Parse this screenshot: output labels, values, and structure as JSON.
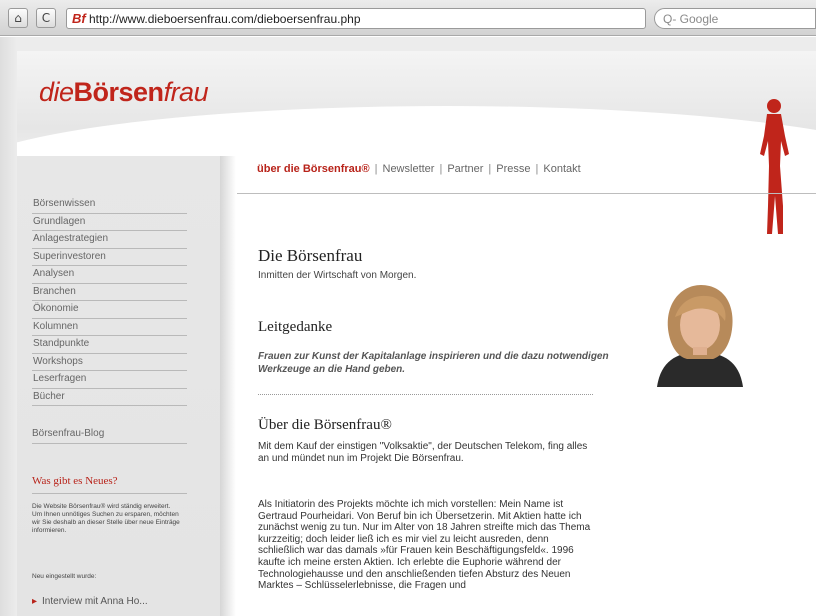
{
  "browser": {
    "home_glyph": "⌂",
    "reload_glyph": "C",
    "favicon_text": "Bf",
    "url": "http://www.dieboersenfrau.com/dieboersenfrau.php",
    "rss_glyph": "◉",
    "search_placeholder": "Q- Google"
  },
  "site": {
    "logo_pre": "die",
    "logo_bold": "Börsen",
    "logo_post": "frau",
    "top_nav": {
      "active": "über die Börsenfrau®",
      "items": [
        "Newsletter",
        "Partner",
        "Presse",
        "Kontakt"
      ],
      "separator": "|"
    },
    "side_menu": [
      "Börsenwissen",
      "Grundlagen",
      "Anlagestrategien",
      "Superinvestoren",
      "Analysen",
      "Branchen",
      "Ökonomie",
      "Kolumnen",
      "Standpunkte",
      "Workshops",
      "Leserfragen",
      "Bücher"
    ],
    "blog": "Börsenfrau-Blog",
    "news": {
      "title": "Was gibt es Neues?",
      "text": "Die Website Börsenfrau® wird ständig erweitert. Um Ihnen unnötiges Suchen zu ersparen, möchten wir Sie deshalb an dieser Stelle über neue Einträge informieren.",
      "sub": "Neu eingestellt wurde:",
      "link": "Interview mit Anna Ho..."
    },
    "main": {
      "h1": "Die Börsenfrau",
      "sub": "Inmitten der Wirtschaft von Morgen.",
      "h2": "Leitgedanke",
      "quote": "Frauen zur Kunst der Kapitalanlage inspirieren und die dazu notwendigen Werkzeuge an die Hand geben.",
      "h3": "Über die Börsenfrau®",
      "p1": "Mit dem Kauf der einstigen \"Volksaktie\", der Deutschen Telekom, fing alles an und mündet nun im Projekt Die Börsenfrau.",
      "p2": "Als Initiatorin des Projekts möchte ich mich vorstellen: Mein Name ist Gertraud Pourheidari. Von Beruf bin ich Übersetzerin. Mit Aktien hatte ich zunächst wenig zu tun. Nur im Alter von 18 Jahren streifte mich das Thema kurzzeitig; doch leider ließ ich es mir viel zu leicht ausreden, denn schließlich war das damals »für Frauen kein Beschäftigungsfeld«. 1996 kaufte ich meine ersten Aktien. Ich erlebte die Euphorie während der Technologiehausse und den anschließenden tiefen Absturz des Neuen Marktes – Schlüsselerlebnisse, die Fragen und"
    }
  },
  "colors": {
    "brand": "#c0251b",
    "text": "#333333"
  }
}
